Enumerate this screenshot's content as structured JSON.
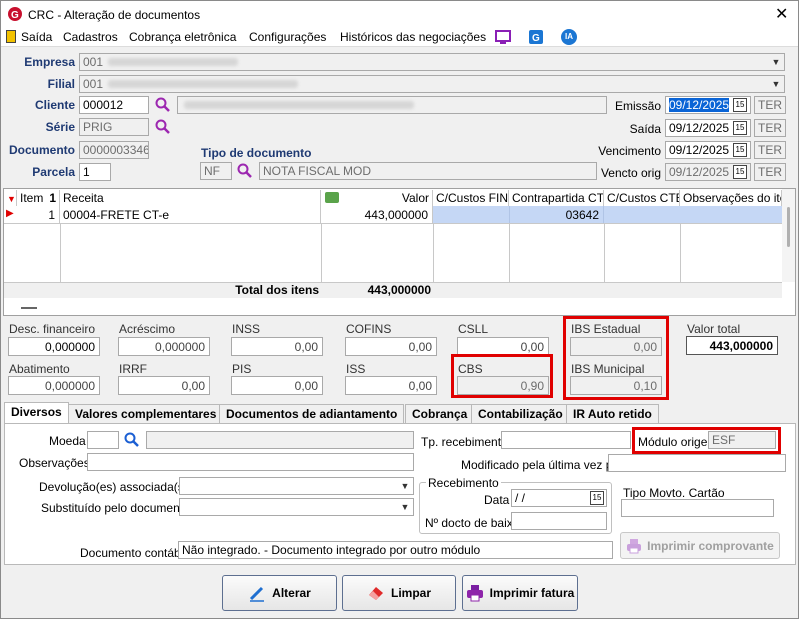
{
  "window": {
    "title": "CRC - Alteração de documentos"
  },
  "menu": {
    "items": [
      "Saída",
      "Cadastros",
      "Cobrança eletrônica",
      "Configurações",
      "Históricos das negociações"
    ],
    "ia_label": "IA"
  },
  "header": {
    "empresa_label": "Empresa",
    "empresa_value": "001",
    "filial_label": "Filial",
    "filial_value": "001",
    "cliente_label": "Cliente",
    "cliente_value": "000012",
    "serie_label": "Série",
    "serie_value": "PRIG",
    "documento_label": "Documento",
    "documento_value": "0000003346",
    "parcela_label": "Parcela",
    "parcela_value": "1",
    "tipo_doc_label": "Tipo de documento",
    "tipo_doc_code": "NF",
    "tipo_doc_desc": "NOTA FISCAL MOD",
    "emissao_label": "Emissão",
    "emissao_value": "09/12/2025",
    "emissao_day": "TER",
    "saida_label": "Saída",
    "saida_value": "09/12/2025",
    "saida_day": "TER",
    "vencimento_label": "Vencimento",
    "vencimento_value": "09/12/2025",
    "vencimento_day": "TER",
    "vencto_orig_label": "Vencto orig",
    "vencto_orig_value": "09/12/2025",
    "vencto_orig_day": "TER"
  },
  "grid": {
    "headers": [
      "Item",
      "Receita",
      "Valor",
      "C/Custos FIN",
      "Contrapartida CTB",
      "C/Custos CTB",
      "Observações do item"
    ],
    "rows": [
      {
        "item": "1",
        "receita": "00004-FRETE CT-e",
        "valor": "443,000000",
        "contrapartida": "03642"
      }
    ],
    "total_label": "Total dos itens",
    "total_value": "443,000000"
  },
  "summary": {
    "desc_fin_label": "Desc. financeiro",
    "desc_fin": "0,000000",
    "acrescimo_label": "Acréscimo",
    "acrescimo": "0,000000",
    "inss_label": "INSS",
    "inss": "0,00",
    "cofins_label": "COFINS",
    "cofins": "0,00",
    "csll_label": "CSLL",
    "csll": "0,00",
    "ibs_est_label": "IBS Estadual",
    "ibs_est": "0,00",
    "valor_total_label": "Valor total",
    "valor_total": "443,000000",
    "abatimento_label": "Abatimento",
    "abatimento": "0,000000",
    "irrf_label": "IRRF",
    "irrf": "0,00",
    "pis_label": "PIS",
    "pis": "0,00",
    "iss_label": "ISS",
    "iss": "0,00",
    "cbs_label": "CBS",
    "cbs": "0,90",
    "ibs_mun_label": "IBS Municipal",
    "ibs_mun": "0,10"
  },
  "tabs": [
    "Diversos",
    "Valores complementares",
    "Documentos de adiantamento",
    "Cobrança",
    "Contabilização",
    "IR Auto retido"
  ],
  "diversos": {
    "moeda_label": "Moeda",
    "observacoes_label": "Observações",
    "devolucao_label": "Devolução(es) associada(s)",
    "substituido_label": "Substituído pelo documento",
    "tp_recebimento_label": "Tp. recebimento",
    "modulo_origem_label": "Módulo origem",
    "modulo_origem_value": "ESF",
    "modificado_label": "Modificado pela última vez por",
    "recebimento_group": "Recebimento",
    "data_label": "Data",
    "data_value": " /  /",
    "n_docto_label": "Nº docto de baixa",
    "tipo_movto_label": "Tipo Movto. Cartão",
    "imprimir_comprovante": "Imprimir comprovante",
    "doc_contabil_label": "Documento contábil",
    "doc_contabil_value": "Não integrado.  - Documento integrado por outro módulo"
  },
  "footer": {
    "alterar": "Alterar",
    "limpar": "Limpar",
    "imprimir_fatura": "Imprimir fatura"
  },
  "colors": {
    "label_blue": "#1f3a73",
    "highlight_red": "#e00000",
    "selection_blue": "#c5d7f5",
    "date_select": "#0a64d6"
  }
}
